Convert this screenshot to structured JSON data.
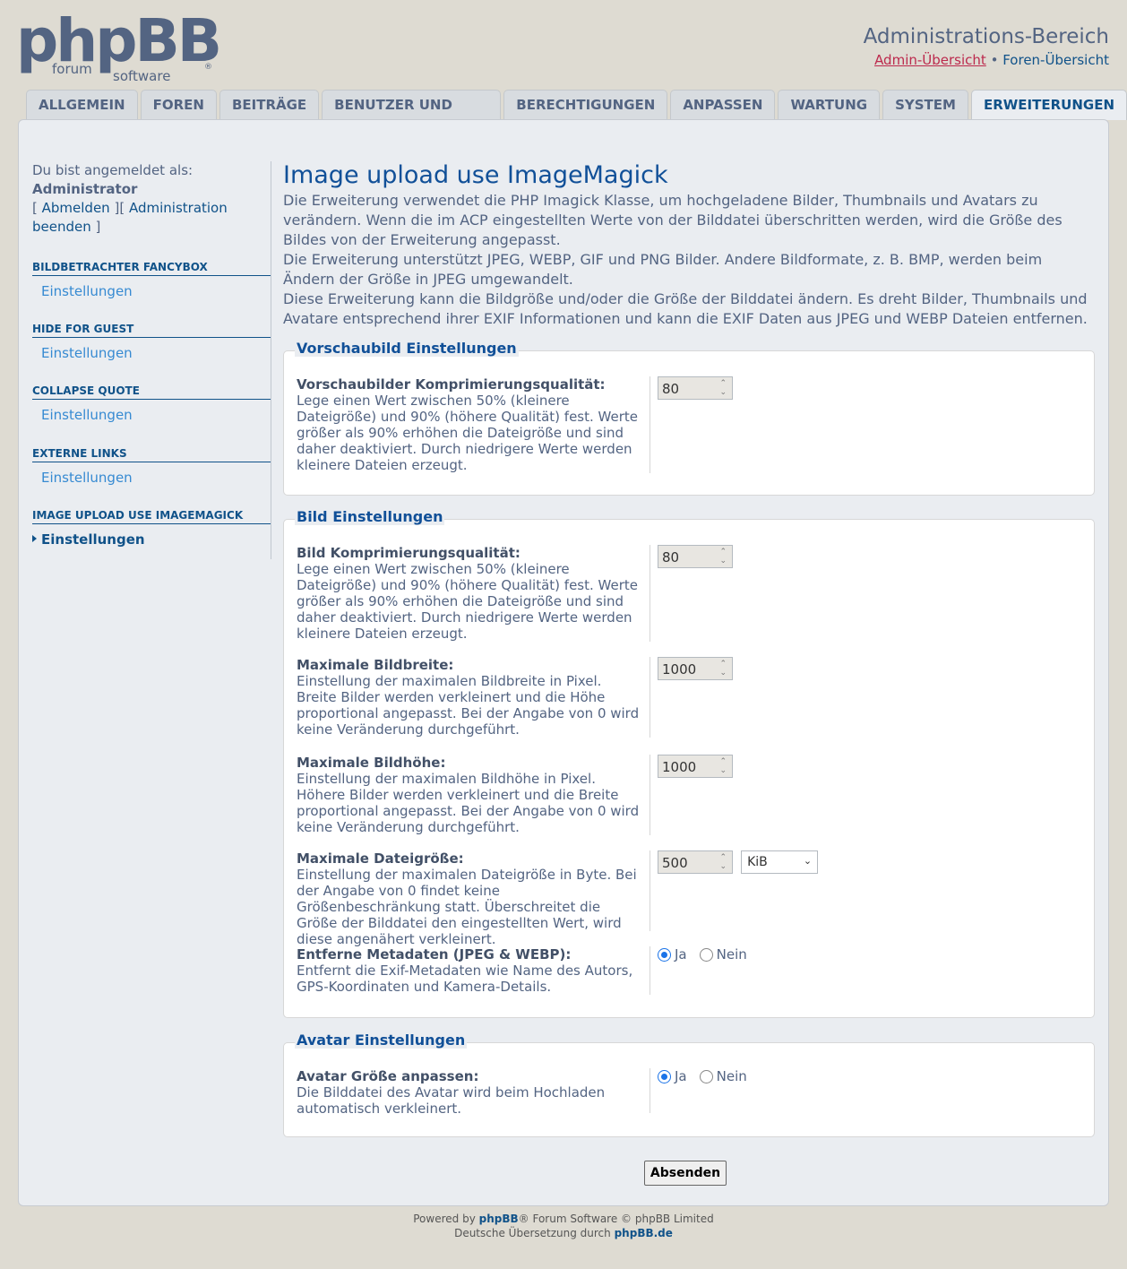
{
  "header": {
    "logo_main": "phpBB",
    "logo_sub1": "forum",
    "logo_sub2": "software",
    "logo_reg": "®",
    "title": "Administrations-Bereich",
    "admin_link": "Admin-Übersicht",
    "separator": "•",
    "forum_link": "Foren-Übersicht"
  },
  "tabs": [
    {
      "label": "ALLGEMEIN"
    },
    {
      "label": "FOREN"
    },
    {
      "label": "BEITRÄGE"
    },
    {
      "label": "BENUTZER UND GRUPPEN"
    },
    {
      "label": "BERECHTIGUNGEN"
    },
    {
      "label": "ANPASSEN"
    },
    {
      "label": "WARTUNG"
    },
    {
      "label": "SYSTEM"
    },
    {
      "label": "ERWEITERUNGEN"
    }
  ],
  "sidebar": {
    "logged_in_as": "Du bist angemeldet als:",
    "username": "Administrator",
    "logout": "Abmelden",
    "end_admin": "Administration beenden",
    "bracket_open": "[",
    "bracket_mid": "][",
    "bracket_close": "]",
    "blocks": [
      {
        "heading": "BILDBETRACHTER FANCYBOX",
        "item": "Einstellungen"
      },
      {
        "heading": "HIDE FOR GUEST",
        "item": "Einstellungen"
      },
      {
        "heading": "COLLAPSE QUOTE",
        "item": "Einstellungen"
      },
      {
        "heading": "EXTERNE LINKS",
        "item": "Einstellungen"
      },
      {
        "heading": "IMAGE UPLOAD USE IMAGEMAGICK",
        "item": "Einstellungen"
      }
    ]
  },
  "main": {
    "title": "Image upload use ImageMagick",
    "intro1": "Die Erweiterung verwendet die PHP Imagick Klasse, um hochgeladene Bilder, Thumbnails und Avatars zu verändern. Wenn die im ACP eingestellten Werte von der Bilddatei überschritten werden, wird die Größe des Bildes von der Erweiterung angepasst.",
    "intro2": "Die Erweiterung unterstützt JPEG, WEBP, GIF und PNG Bilder. Andere Bildformate, z. B. BMP, werden beim Ändern der Größe in JPEG umgewandelt.",
    "intro3": "Diese Erweiterung kann die Bildgröße und/oder die Größe der Bilddatei ändern. Es dreht Bilder, Thumbnails und Avatare entsprechend ihrer EXIF Informationen und kann die EXIF Daten aus JPEG und WEBP Dateien entfernen."
  },
  "thumb": {
    "legend": "Vorschaubild Einstellungen",
    "quality_label": "Vorschaubilder Komprimierungsqualität:",
    "quality_expl": "Lege einen Wert zwischen 50% (kleinere Dateigröße) und 90% (höhere Qualität) fest. Werte größer als 90% erhöhen die Dateigröße und sind daher deaktiviert. Durch niedrigere Werte werden kleinere Dateien erzeugt.",
    "quality_value": "80"
  },
  "image": {
    "legend": "Bild Einstellungen",
    "quality_label": "Bild Komprimierungsqualität:",
    "quality_expl": "Lege einen Wert zwischen 50% (kleinere Dateigröße) und 90% (höhere Qualität) fest. Werte größer als 90% erhöhen die Dateigröße und sind daher deaktiviert. Durch niedrigere Werte werden kleinere Dateien erzeugt.",
    "quality_value": "80",
    "width_label": "Maximale Bildbreite:",
    "width_expl": "Einstellung der maximalen Bildbreite in Pixel. Breite Bilder werden verkleinert und die Höhe proportional angepasst. Bei der Angabe von 0 wird keine Veränderung durchgeführt.",
    "width_value": "1000",
    "height_label": "Maximale Bildhöhe:",
    "height_expl": "Einstellung der maximalen Bildhöhe in Pixel. Höhere Bilder werden verkleinert und die Breite proportional angepasst. Bei der Angabe von 0 wird keine Veränderung durchgeführt.",
    "height_value": "1000",
    "filesize_label": "Maximale Dateigröße:",
    "filesize_expl": "Einstellung der maximalen Dateigröße in Byte. Bei der Angabe von 0 findet keine Größenbeschränkung statt. Überschreitet die Größe der Bilddatei den eingestellten Wert, wird diese angenähert verkleinert.",
    "filesize_value": "500",
    "filesize_unit": "KiB",
    "metadata_label": "Entferne Metadaten (JPEG & WEBP):",
    "metadata_expl": "Entfernt die Exif-Metadaten wie Name des Autors, GPS-Koordinaten und Kamera-Details.",
    "yes": "Ja",
    "no": "Nein"
  },
  "avatar": {
    "legend": "Avatar Einstellungen",
    "resize_label": "Avatar Größe anpassen:",
    "resize_expl": "Die Bilddatei des Avatar wird beim Hochladen automatisch verkleinert.",
    "yes": "Ja",
    "no": "Nein"
  },
  "submit_label": "Absenden",
  "footer": {
    "powered_prefix": "Powered by",
    "phpbb": "phpBB",
    "powered_suffix": "® Forum Software © phpBB Limited",
    "translation_prefix": "Deutsche Übersetzung durch",
    "phpbb_de": "phpBB.de"
  }
}
